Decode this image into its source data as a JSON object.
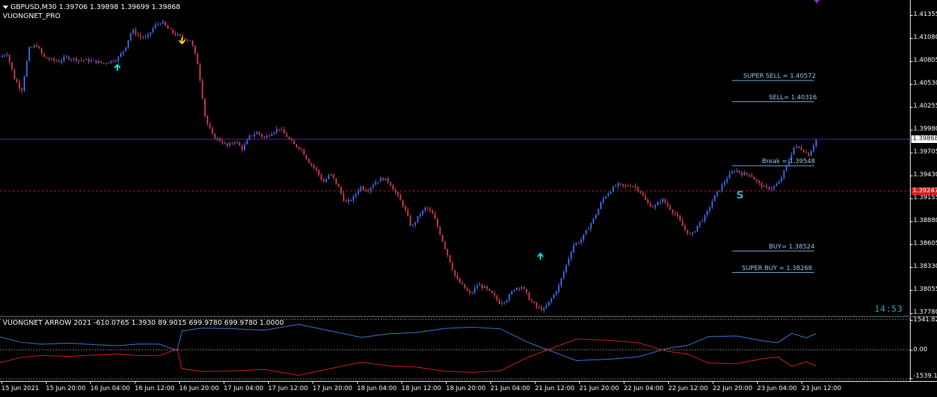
{
  "header": {
    "symbol_line": "GBPUSD,M30  1.39706 1.39898 1.39699 1.39868",
    "indicator_name": "VUONGNET_PRO"
  },
  "sub_header": "VUONGNET ARROW 2021  -610.0765 1.3930 89.9015 699.9780 699.9780 1.0000",
  "levels": {
    "super_sell": "SUPER SELL = 1.40572",
    "sell": "SELL= 1.40316",
    "break": "Break = 1.39548",
    "buy": "BUY= 1.38524",
    "super_buy": "SUPER BUY = 1.38268"
  },
  "signal_letter": "S",
  "countdown": "14:53",
  "price_axis": [
    "1.41355",
    "1.41080",
    "1.40805",
    "1.40530",
    "1.40255",
    "1.39980",
    "1.39705",
    "1.39430",
    "1.39155",
    "1.38880",
    "1.38605",
    "1.38330",
    "1.38055",
    "1.37780"
  ],
  "current_price": "1.39868",
  "red_line_price": "1.39247",
  "sub_axis": {
    "top": "1541.820",
    "mid": "0.00",
    "bottom": "-1539.11"
  },
  "time_axis": [
    "15 Jun 2021",
    "15 Jun 20:00",
    "16 Jun 04:00",
    "16 Jun 12:00",
    "16 Jun 20:00",
    "17 Jun 04:00",
    "17 Jun 12:00",
    "17 Jun 20:00",
    "18 Jun 04:00",
    "18 Jun 12:00",
    "18 Jun 20:00",
    "21 Jun 04:00",
    "21 Jun 12:00",
    "21 Jun 20:00",
    "22 Jun 04:00",
    "22 Jun 12:00",
    "22 Jun 20:00",
    "23 Jun 04:00",
    "23 Jun 12:00"
  ],
  "colors": {
    "bull": "#3c6ef0",
    "bear": "#d03c50",
    "arrow_up": "#00e5e5",
    "arrow_down": "#ffe000",
    "current_line": "#5a1f9a",
    "red_level": "#d02020",
    "level_line": "#7fb0e0",
    "osc_red": "#e02020",
    "osc_blue": "#3a7ee0"
  },
  "icons": [
    "down-triangle-icon",
    "arrow-up-icon",
    "arrow-down-icon"
  ],
  "price_path": [
    1.4085,
    1.409,
    1.406,
    1.4045,
    1.4095,
    1.41,
    1.4085,
    1.4082,
    1.408,
    1.4085,
    1.4083,
    1.4082,
    1.4081,
    1.408,
    1.4078,
    1.408,
    1.4083,
    1.4095,
    1.4118,
    1.411,
    1.4108,
    1.4122,
    1.4128,
    1.4118,
    1.4112,
    1.4108,
    1.4105,
    1.4075,
    1.401,
    1.399,
    1.3985,
    1.3978,
    1.3985,
    1.3975,
    1.399,
    1.3995,
    1.3988,
    1.3995,
    1.4,
    1.399,
    1.398,
    1.3975,
    1.396,
    1.395,
    1.3935,
    1.3945,
    1.393,
    1.391,
    1.3915,
    1.393,
    1.3925,
    1.3935,
    1.394,
    1.3935,
    1.392,
    1.3905,
    1.388,
    1.3895,
    1.3905,
    1.3895,
    1.387,
    1.3845,
    1.382,
    1.381,
    1.38,
    1.3812,
    1.3808,
    1.38,
    1.379,
    1.3795,
    1.3808,
    1.381,
    1.3795,
    1.3785,
    1.3782,
    1.3795,
    1.381,
    1.3835,
    1.386,
    1.3865,
    1.388,
    1.3895,
    1.3915,
    1.3925,
    1.3932,
    1.393,
    1.3932,
    1.3925,
    1.391,
    1.3905,
    1.3915,
    1.3905,
    1.3895,
    1.388,
    1.387,
    1.3885,
    1.3895,
    1.3915,
    1.3928,
    1.3942,
    1.395,
    1.3945,
    1.3945,
    1.3935,
    1.3928,
    1.3928,
    1.3935,
    1.3955,
    1.3978,
    1.3975,
    1.3968,
    1.3986
  ]
}
